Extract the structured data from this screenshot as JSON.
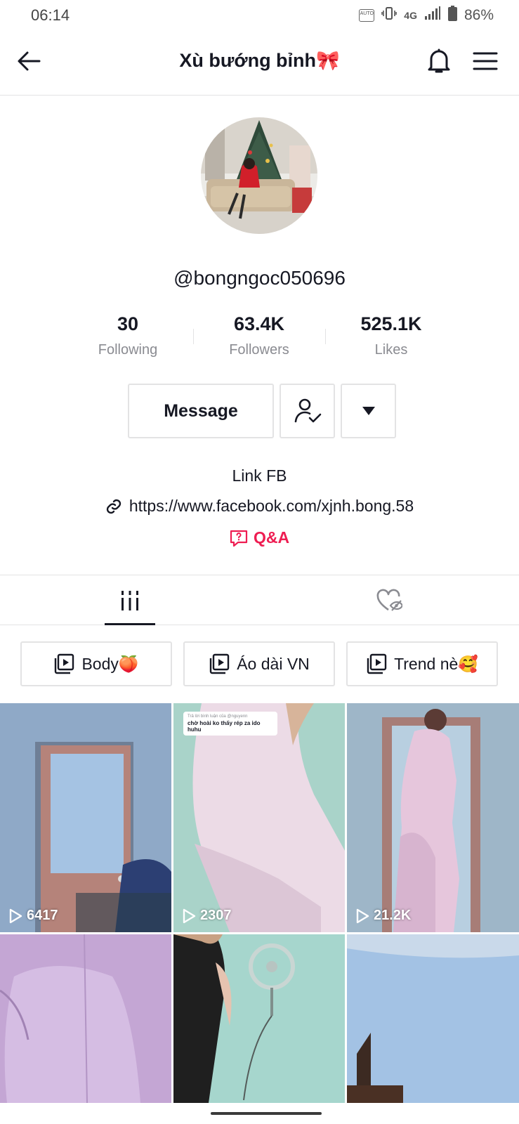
{
  "status_bar": {
    "time": "06:14",
    "auto_label": "AUTO",
    "network": "4G",
    "battery": "86%"
  },
  "header": {
    "title": "Xù bướng bỉnh🎀"
  },
  "profile": {
    "username": "@bongngoc050696",
    "stats": [
      {
        "value": "30",
        "label": "Following"
      },
      {
        "value": "63.4K",
        "label": "Followers"
      },
      {
        "value": "525.1K",
        "label": "Likes"
      }
    ],
    "message_label": "Message",
    "bio": "Link FB",
    "link": "https://www.facebook.com/xjnh.bong.58",
    "qa_label": "Q&A"
  },
  "playlists": [
    {
      "label": "Body🍑"
    },
    {
      "label": "Áo dài VN"
    },
    {
      "label": "Trend nè🥰"
    }
  ],
  "videos": [
    {
      "views": "6417"
    },
    {
      "views": "2307",
      "caption_header": "Trả lời bình luận của @nguyenn",
      "caption": "chờ hoài ko thấy rép za ido huhu"
    },
    {
      "views": "21.2K"
    },
    {
      "views": ""
    },
    {
      "views": ""
    },
    {
      "views": ""
    }
  ],
  "colors": {
    "accent_red": "#ee1d52",
    "text": "#161823",
    "muted": "#8a8b91",
    "border": "#e3e3e4"
  }
}
